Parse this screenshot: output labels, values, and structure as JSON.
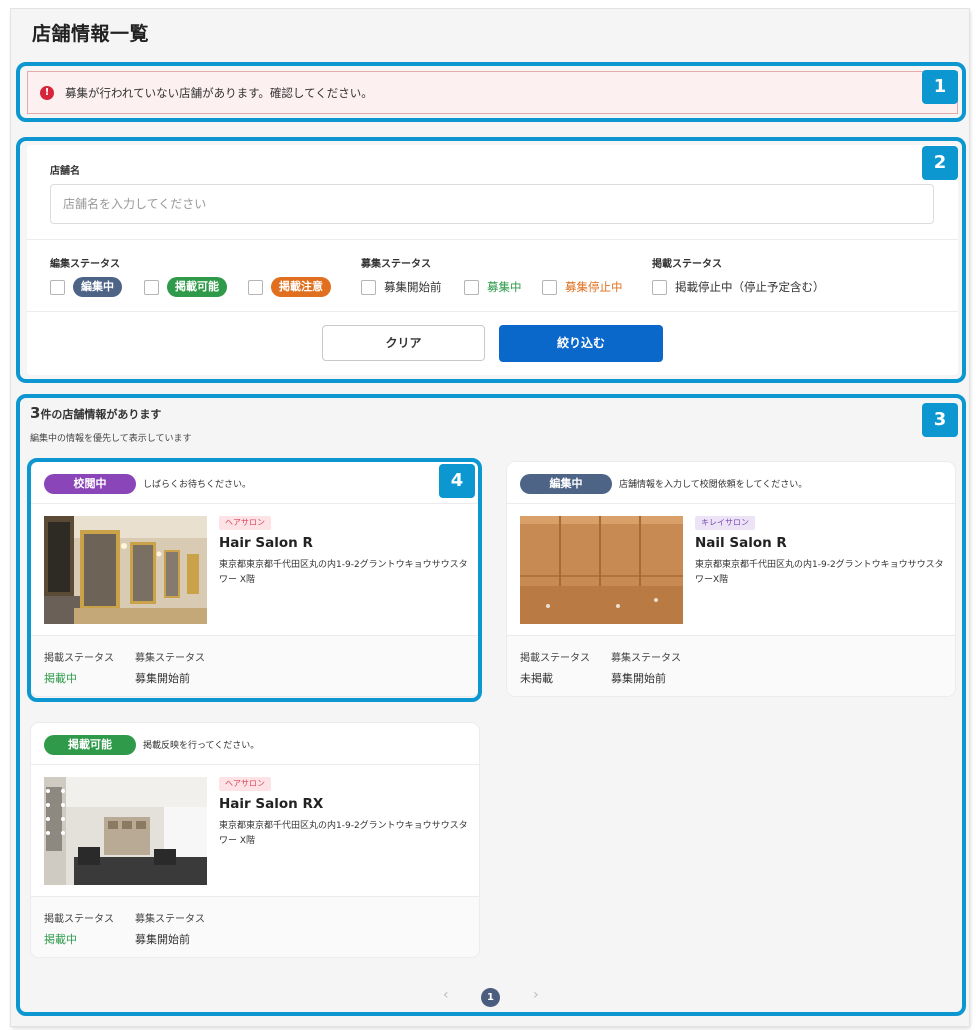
{
  "page": {
    "title": "店舗情報一覧"
  },
  "alert": {
    "message": "募集が行われていない店舗があります。確認してください。",
    "icon": "exclamation-circle-icon"
  },
  "callouts": [
    "1",
    "2",
    "3",
    "4"
  ],
  "filter": {
    "shop_name_label": "店舗名",
    "shop_name_placeholder": "店舗名を入力してください",
    "edit_status": {
      "label": "編集ステータス",
      "options": [
        {
          "label": "編集中",
          "color": "#4d6487"
        },
        {
          "label": "掲載可能",
          "color": "#2e9a4a"
        },
        {
          "label": "掲載注意",
          "color": "#e0701f"
        }
      ]
    },
    "recruit_status": {
      "label": "募集ステータス",
      "options": [
        {
          "label": "募集開始前",
          "color": "#333333"
        },
        {
          "label": "募集中",
          "color": "#2e9a4a"
        },
        {
          "label": "募集停止中",
          "color": "#e0701f"
        }
      ]
    },
    "publish_status": {
      "label": "掲載ステータス",
      "options": [
        {
          "label": "掲載停止中（停止予定含む）",
          "color": "#333333"
        }
      ]
    },
    "clear_button": "クリア",
    "apply_button": "絞り込む"
  },
  "results": {
    "count": "3",
    "count_suffix": "件の店舗情報があります",
    "note": "編集中の情報を優先して表示しています"
  },
  "cards": [
    {
      "status": "校閲中",
      "status_color": "#8a45b8",
      "message": "しばらくお待ちください。",
      "category": "ヘアサロン",
      "name": "Hair Salon R",
      "address": "東京都東京都千代田区丸の内1-9-2グラントウキョウサウスタワー X階",
      "publish_label": "掲載ステータス",
      "publish_value": "掲載中",
      "publish_color": "#2e9a4a",
      "recruit_label": "募集ステータス",
      "recruit_value": "募集開始前"
    },
    {
      "status": "編集中",
      "status_color": "#4d6487",
      "message": "店舗情報を入力して校閲依頼をしてください。",
      "category": "キレイサロン",
      "name": "Nail Salon R",
      "address": "東京都東京都千代田区丸の内1-9-2グラントウキョウサウスタワーX階",
      "publish_label": "掲載ステータス",
      "publish_value": "未掲載",
      "publish_color": "#333333",
      "recruit_label": "募集ステータス",
      "recruit_value": "募集開始前"
    },
    {
      "status": "掲載可能",
      "status_color": "#2e9a4a",
      "message": "掲載反映を行ってください。",
      "category": "ヘアサロン",
      "name": "Hair Salon RX",
      "address": "東京都東京都千代田区丸の内1-9-2グラントウキョウサウスタワー X階",
      "publish_label": "掲載ステータス",
      "publish_value": "掲載中",
      "publish_color": "#2e9a4a",
      "recruit_label": "募集ステータス",
      "recruit_value": "募集開始前"
    }
  ],
  "pagination": {
    "prev": "‹",
    "current": "1",
    "next": "›"
  }
}
